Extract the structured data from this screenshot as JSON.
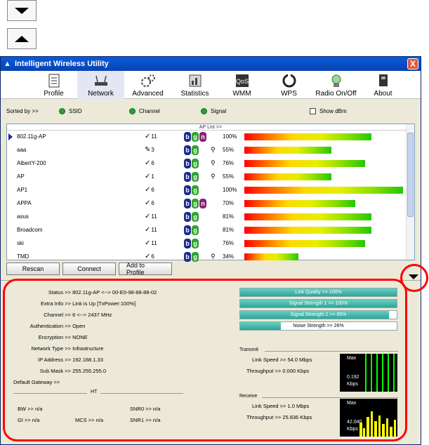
{
  "window": {
    "title": "Intelligent Wireless Utility",
    "close_glyph": "X"
  },
  "toolbar": {
    "items": [
      {
        "label": "Profile",
        "icon": "profile-icon"
      },
      {
        "label": "Network",
        "icon": "network-icon"
      },
      {
        "label": "Advanced",
        "icon": "advanced-gears-icon"
      },
      {
        "label": "Statistics",
        "icon": "statistics-icon"
      },
      {
        "label": "WMM",
        "icon": "wmm-icon"
      },
      {
        "label": "WPS",
        "icon": "wps-icon"
      },
      {
        "label": "Radio On/Off",
        "icon": "radio-icon"
      },
      {
        "label": "About",
        "icon": "about-icon"
      }
    ]
  },
  "sort": {
    "label": "Sorted by >>",
    "ssid": "SSID",
    "channel": "Channel",
    "signal": "Signal",
    "show_dbm": "Show dBm"
  },
  "ap_list": {
    "header": "AP List >>",
    "rows": [
      {
        "ssid": "802.11g-AP",
        "channel": "11",
        "icon": "infrastructure",
        "modes": [
          "b",
          "g",
          "n"
        ],
        "lock": false,
        "signal": 100,
        "bar": 0.8
      },
      {
        "ssid": "aaa",
        "channel": "3",
        "icon": "adhoc",
        "modes": [
          "b",
          "g"
        ],
        "lock": true,
        "signal": 55,
        "bar": 0.55
      },
      {
        "ssid": "AlbertY-200",
        "channel": "6",
        "icon": "infrastructure",
        "modes": [
          "b",
          "g"
        ],
        "lock": true,
        "signal": 76,
        "bar": 0.76
      },
      {
        "ssid": "AP",
        "channel": "1",
        "icon": "infrastructure",
        "modes": [
          "b",
          "g"
        ],
        "lock": true,
        "signal": 55,
        "bar": 0.55
      },
      {
        "ssid": "AP1",
        "channel": "6",
        "icon": "infrastructure",
        "modes": [
          "b",
          "g"
        ],
        "lock": false,
        "signal": 100,
        "bar": 1.0
      },
      {
        "ssid": "APPA",
        "channel": "6",
        "icon": "infrastructure",
        "modes": [
          "b",
          "g",
          "n"
        ],
        "lock": false,
        "signal": 70,
        "bar": 0.7
      },
      {
        "ssid": "asus",
        "channel": "11",
        "icon": "infrastructure",
        "modes": [
          "b",
          "g"
        ],
        "lock": false,
        "signal": 81,
        "bar": 0.8
      },
      {
        "ssid": "Broadcom",
        "channel": "11",
        "icon": "infrastructure",
        "modes": [
          "b",
          "g"
        ],
        "lock": false,
        "signal": 81,
        "bar": 0.8
      },
      {
        "ssid": "ski",
        "channel": "11",
        "icon": "infrastructure",
        "modes": [
          "b",
          "g"
        ],
        "lock": false,
        "signal": 76,
        "bar": 0.76
      },
      {
        "ssid": "TMD",
        "channel": "6",
        "icon": "infrastructure",
        "modes": [
          "b",
          "g"
        ],
        "lock": true,
        "signal": 34,
        "bar": 0.34
      }
    ]
  },
  "buttons": {
    "rescan": "Rescan",
    "connect": "Connect",
    "add_to_profile": "Add to Profile"
  },
  "status": {
    "status": {
      "key": "Status >>",
      "value": "802.11g-AP <--> 00-E0-98-88-88-02"
    },
    "extra_info": {
      "key": "Extra Info >>",
      "value": "Link is Up [TxPower:100%]"
    },
    "channel": {
      "key": "Channel >>",
      "value": "6 <--> 2437 MHz"
    },
    "authentication": {
      "key": "Authentication >>",
      "value": "Open"
    },
    "encryption": {
      "key": "Encryption >>",
      "value": "NONE"
    },
    "network_type": {
      "key": "Network Type >>",
      "value": "Infrastructure"
    },
    "ip_address": {
      "key": "IP Address >>",
      "value": "192.168.1.33"
    },
    "sub_mask": {
      "key": "Sub Mask >>",
      "value": "255.255.255.0"
    },
    "default_gateway": {
      "key": "Default Gateway >>",
      "value": ""
    }
  },
  "ht": {
    "title": "HT",
    "bw": "BW >> n/a",
    "gi": "GI >> n/a",
    "mcs": "MCS >> n/a",
    "snr0": "SNR0 >> n/a",
    "snr1": "SNR1 >> n/a"
  },
  "quality": {
    "link_quality": {
      "label": "Link Quality >> 100%",
      "value": 100
    },
    "signal1": {
      "label": "Signal Strength 1 >> 100%",
      "value": 100
    },
    "signal2": {
      "label": "Signal Strength 2 >> 95%",
      "value": 95
    },
    "noise": {
      "label": "Noise Strength >> 26%",
      "value": 26
    }
  },
  "transmit": {
    "title": "Transmit",
    "link_speed": "Link Speed >> 54.0 Mbps",
    "throughput": "Throughput >> 0.000 Kbps",
    "graph": {
      "max": "Max",
      "value": "0.192",
      "unit": "Kbps"
    }
  },
  "receive": {
    "title": "Receive",
    "link_speed": "Link Speed >> 1.0 Mbps",
    "throughput": "Throughput >> 25.836 Kbps",
    "graph": {
      "max": "Max",
      "value": "42.040",
      "unit": "Kbps"
    }
  },
  "colors": {
    "titlebar": "#0842b3",
    "highlight": "#ff0000",
    "quality_fill": "#2ea59a"
  }
}
